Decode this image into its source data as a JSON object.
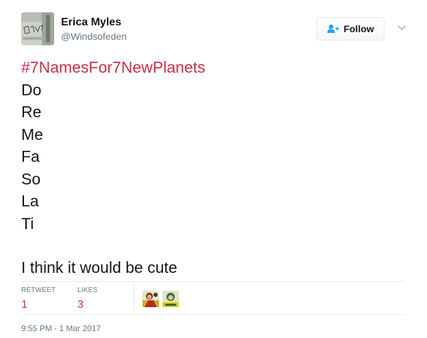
{
  "user": {
    "name": "Erica Myles",
    "handle": "@Windsofeden",
    "avatar_icon": "avatar-image"
  },
  "follow_button": {
    "label": "Follow",
    "icon": "add-user-icon"
  },
  "menu_icon": "chevron-down-icon",
  "tweet": {
    "hashtag": "#7NamesFor7NewPlanets",
    "lines": [
      "Do",
      "Re",
      "Me",
      "Fa",
      "So",
      "La",
      "Ti"
    ],
    "closing": "I think it would be cute"
  },
  "stats": {
    "retweets_label": "RETWEET",
    "retweets_count": "1",
    "likes_label": "LIKES",
    "likes_count": "3"
  },
  "likers": [
    "liker-avatar-1",
    "liker-avatar-2"
  ],
  "timestamp": "9:55 PM - 1 Mar 2017",
  "colors": {
    "accent": "#ca2e48",
    "text": "#14171a",
    "muted": "#657786",
    "border": "#e1e8ed"
  }
}
